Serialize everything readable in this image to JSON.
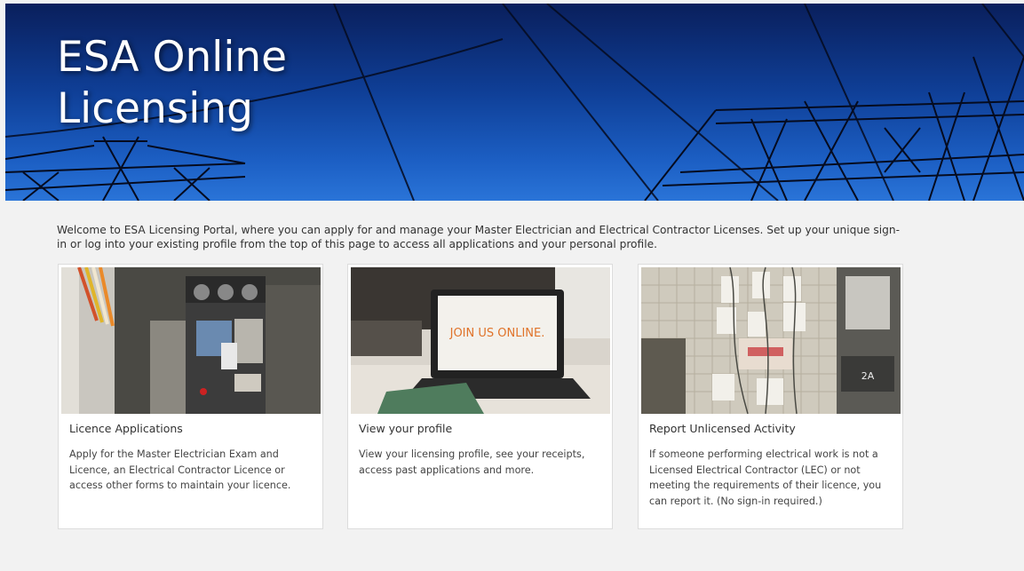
{
  "hero": {
    "title": "ESA Online Licensing"
  },
  "intro": "Welcome to ESA Licensing Portal, where you can apply for and manage your Master Electrician and Electrical Contractor Licenses. Set up your unique sign-in or log into your existing profile from the top of this page to access all applications and your personal profile.",
  "cards": [
    {
      "title": "Licence Applications",
      "description": "Apply for the Master Electrician Exam and Licence, an Electrical Contractor Licence or access other forms to maintain your licence."
    },
    {
      "title": "View your profile",
      "description": "View your licensing profile, see your receipts, access past applications and more.",
      "laptop_screen_text": "JOIN US ONLINE."
    },
    {
      "title": "Report Unlicensed Activity",
      "description": "If someone performing electrical work is not a Licensed Electrical Contractor (LEC) or not meeting the requirements of their licence, you can report it. (No sign-in required.)",
      "door_sign_text": "2A"
    }
  ],
  "colors": {
    "hero_blue": "#0f3f97",
    "page_bg": "#f2f2f2",
    "card_border": "#dcdcdc"
  }
}
